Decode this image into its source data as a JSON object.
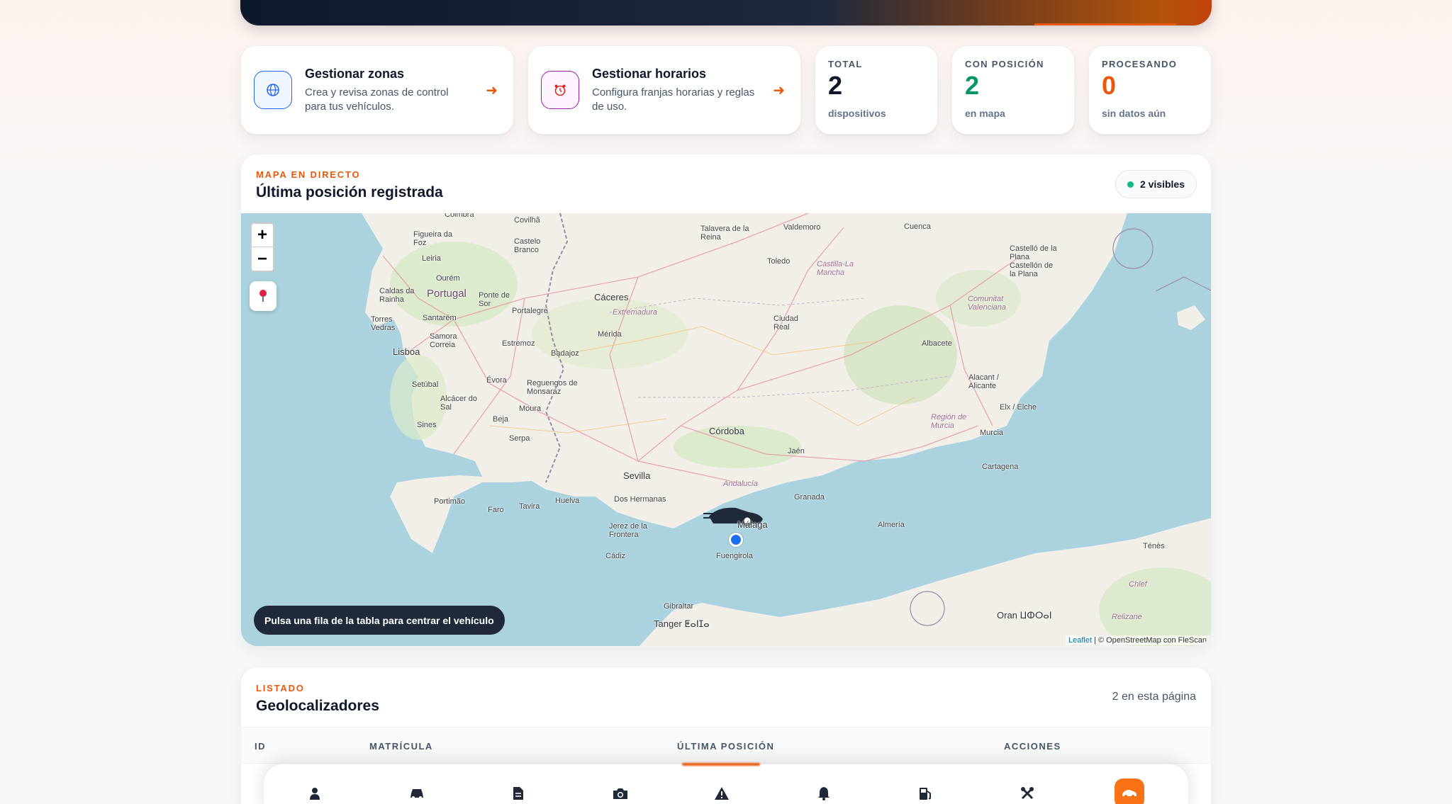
{
  "cards": {
    "zones": {
      "title": "Gestionar zonas",
      "desc": "Crea y revisa zonas de control para tus vehículos.",
      "arrow": "➜"
    },
    "schedules": {
      "title": "Gestionar horarios",
      "desc": "Configura franjas horarias y reglas de uso.",
      "arrow": "➜"
    }
  },
  "stats": [
    {
      "label": "TOTAL",
      "value": "2",
      "sub": "dispositivos",
      "color": "#0f172a"
    },
    {
      "label": "CON POSICIÓN",
      "value": "2",
      "sub": "en mapa",
      "color": "#059669"
    },
    {
      "label": "PROCESANDO",
      "value": "0",
      "sub": "sin datos aún",
      "color": "#ea580c"
    }
  ],
  "map_panel": {
    "kicker": "MAPA EN DIRECTO",
    "title": "Última posición registrada",
    "visible_badge": "2 visibles",
    "zoom_in": "+",
    "zoom_out": "−",
    "hint": "Pulsa una fila de la tabla para centrar el vehículo",
    "attribution_leaflet": "Leaflet",
    "attribution_rest": " | © OpenStreetMap con FleScan",
    "places": {
      "coimbra": "Coimbra",
      "covilha": "Covilhã",
      "figueira": "Figueira da Foz",
      "leiria": "Leiria",
      "ourem": "Ourém",
      "castelo_branco": "Castelo Branco",
      "caldas": "Caldas da Rainha",
      "portugal": "Portugal",
      "ponte_de_sor": "Ponte de Sor",
      "santarem": "Santarém",
      "torres_vedras": "Torres Vedras",
      "samora": "Samora Correia",
      "lisboa": "Lisboa",
      "setubal": "Setúbal",
      "alcacer": "Alcácer do Sal",
      "sines": "Sines",
      "evora": "Évora",
      "reguengos": "Reguengos de Monsaraz",
      "beja": "Beja",
      "moura": "Moura",
      "serpa": "Serpa",
      "portimao": "Portimão",
      "faro": "Faro",
      "tavira": "Tavira",
      "portalegre": "Portalegre",
      "estremoz": "Estremoz",
      "badajoz": "Badajoz",
      "caceres": "Cáceres",
      "extremadura": "Extremadura",
      "merida": "Mérida",
      "talavera": "Talavera de la Reina",
      "valdemoro": "Valdemoro",
      "toledo": "Toledo",
      "cuenca": "Cuenca",
      "castilla": "Castilla-La Mancha",
      "ciudad_real": "Ciudad Real",
      "castello": "Castelló de la Plana Castellón de la Plana",
      "comunitat": "Comunitat Valenciana",
      "albacete": "Albacete",
      "alicante": "Alacant / Alicante",
      "elx": "Elx / Elche",
      "murcia_region": "Región de Murcia",
      "murcia": "Murcia",
      "cartagena": "Cartagena",
      "cordoba": "Córdoba",
      "jaen": "Jaén",
      "sevilla": "Sevilla",
      "andalucia": "Andalucía",
      "huelva": "Huelva",
      "dos_hermanas": "Dos Hermanas",
      "granada": "Granada",
      "malaga": "Málaga",
      "almeria": "Almería",
      "jerez": "Jerez de la Frontera",
      "cadiz": "Cádiz",
      "fuengirola": "Fuengirola",
      "gibraltar": "Gibraltar",
      "tanger": "Tanger ⵟⴰⵏⵊⴰ",
      "oran": "Oran ⵡⵀⵔⴰⵏ",
      "relizane": "Relizane",
      "chlef": "Chlef",
      "tenes": "Ténès"
    }
  },
  "list_panel": {
    "kicker": "LISTADO",
    "title": "Geolocalizadores",
    "page_count": "2 en esta página",
    "columns": [
      "ID",
      "MATRÍCULA",
      "ÚLTIMA POSICIÓN",
      "ACCIONES"
    ]
  },
  "dock": {
    "items": [
      "user-icon",
      "car-icon",
      "document-icon",
      "camera-icon",
      "warning-icon",
      "bell-icon",
      "fuel-icon",
      "tools-icon",
      "vehicle-icon"
    ],
    "active": "vehicle-icon"
  },
  "colors": {
    "accent": "#ea580c",
    "green": "#059669",
    "dark": "#0f172a"
  }
}
